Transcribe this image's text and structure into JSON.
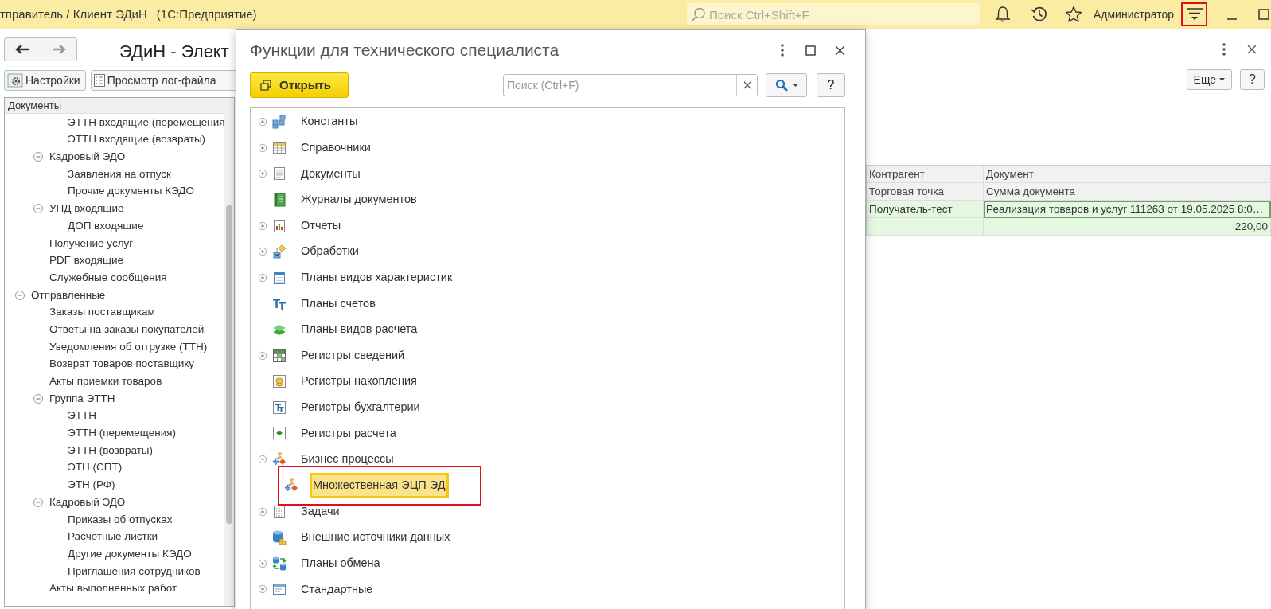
{
  "window": {
    "title": "тправитель / Клиент ЭДиН",
    "app": "(1С:Предприятие)"
  },
  "top_bar": {
    "search": {
      "placeholder": "Поиск Ctrl+Shift+F"
    },
    "user": "Администратор",
    "menu_button": {
      "highlighted": true
    }
  },
  "form": {
    "title": "ЭДиН - Элект",
    "toolbar": [
      "Настройки",
      "Просмотр лог-файла"
    ],
    "tree": {
      "header": "Документы",
      "items": [
        {
          "children": [
            {
              "children": [
                {
                  "label": "ЭТТН входящие (перемещения"
                },
                {
                  "label": "ЭТТН входящие (возвраты)"
                }
              ]
            },
            {
              "label": "Кадровый ЭДО",
              "expanded": true,
              "children": [
                {
                  "label": "Заявления на отпуск"
                },
                {
                  "label": "Прочие документы КЭДО"
                }
              ]
            },
            {
              "label": "УПД входящие",
              "expanded": true,
              "children": [
                {
                  "label": "ДОП входящие"
                }
              ]
            },
            {
              "label": "Получение услуг"
            },
            {
              "label": "PDF входящие"
            },
            {
              "label": "Служебные сообщения"
            }
          ]
        },
        {
          "label": "Отправленные",
          "expanded": true,
          "children": [
            {
              "label": "Заказы поставщикам"
            },
            {
              "label": "Ответы на заказы покупателей"
            },
            {
              "label": "Уведомления об отгрузке (ТТН)"
            },
            {
              "label": "Возврат товаров поставщику"
            },
            {
              "label": "Акты приемки товаров"
            },
            {
              "label": "Группа ЭТТН",
              "expanded": true,
              "children": [
                {
                  "label": "ЭТТН"
                },
                {
                  "label": "ЭТТН (перемещения)"
                },
                {
                  "label": "ЭТТН (возвраты)"
                },
                {
                  "label": "ЭТН (СПТ)"
                },
                {
                  "label": "ЭТН (РФ)"
                }
              ]
            },
            {
              "label": "Кадровый ЭДО",
              "expanded": true,
              "children": [
                {
                  "label": "Приказы об отпусках"
                },
                {
                  "label": "Расчетные листки"
                },
                {
                  "label": "Другие документы КЭДО"
                },
                {
                  "label": "Приглашения сотрудников"
                }
              ]
            },
            {
              "label": "Акты выполненных работ"
            }
          ]
        }
      ]
    }
  },
  "dialog": {
    "title": "Функции для технического специалиста",
    "open_button": "Открыть",
    "search": {
      "placeholder": "Поиск (Ctrl+F)"
    },
    "help": "?",
    "items": [
      {
        "label": "Константы",
        "expanded": false,
        "selected": false
      },
      {
        "label": "Справочники",
        "expanded": false,
        "selected": false
      },
      {
        "label": "Документы",
        "expanded": false,
        "selected": false
      },
      {
        "label": "Журналы документов",
        "selected": false
      },
      {
        "label": "Отчеты",
        "expanded": false,
        "selected": false
      },
      {
        "label": "Обработки",
        "expanded": false,
        "selected": false
      },
      {
        "label": "Планы видов характеристик",
        "expanded": false,
        "selected": false
      },
      {
        "label": "Планы счетов",
        "selected": false
      },
      {
        "label": "Планы видов расчета",
        "selected": false
      },
      {
        "label": "Регистры сведений",
        "expanded": false,
        "selected": false
      },
      {
        "label": "Регистры накопления",
        "selected": false
      },
      {
        "label": "Регистры бухгалтерии",
        "selected": false
      },
      {
        "label": "Регистры расчета",
        "selected": false
      },
      {
        "label": "Бизнес процессы",
        "expanded": true,
        "selected": false,
        "children": [
          {
            "label": "Множественная ЭЦП ЭД",
            "selected": true,
            "highlighted": true
          }
        ]
      },
      {
        "label": "Задачи",
        "expanded": false,
        "selected": false
      },
      {
        "label": "Внешние источники данных",
        "selected": false
      },
      {
        "label": "Планы обмена",
        "expanded": false,
        "selected": false
      },
      {
        "label": "Стандартные",
        "expanded": false,
        "selected": false
      }
    ]
  },
  "list": {
    "more_button": "Еще",
    "help": "?",
    "header_rows": [
      [
        "Контрагент",
        "Документ"
      ],
      [
        "Торговая точка",
        "Сумма документа"
      ]
    ],
    "rows": [
      {
        "counterparty": "Получатель-тест",
        "document": "Реализация товаров и услуг 111263 от 19.05.2025 8:0…",
        "amount": "220,00",
        "selected": true
      }
    ]
  }
}
